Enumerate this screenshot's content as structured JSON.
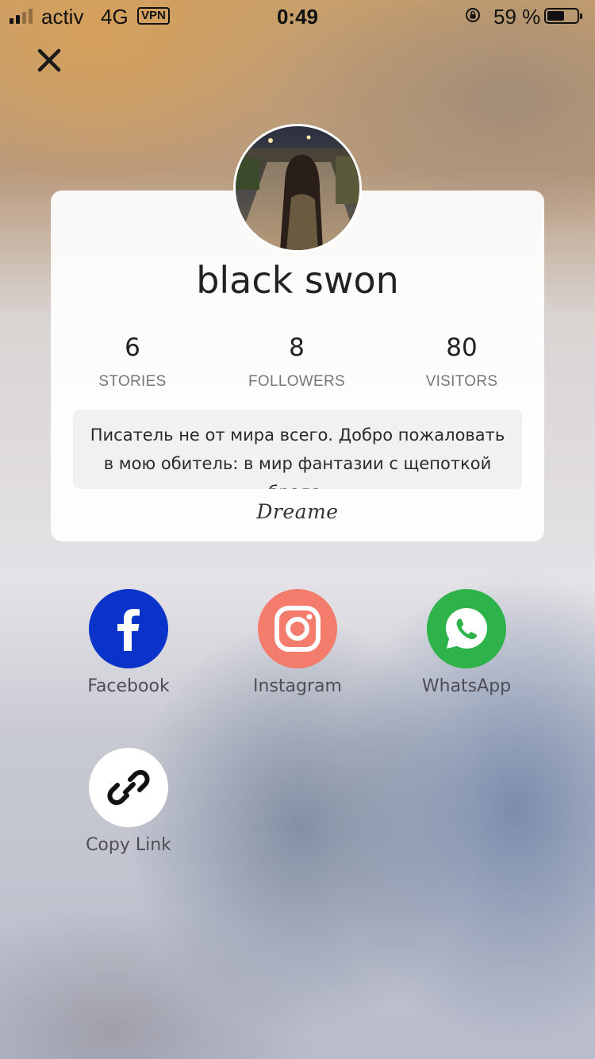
{
  "status_bar": {
    "carrier": "activ",
    "network": "4G",
    "vpn": "VPN",
    "time": "0:49",
    "battery_percent": "59 %",
    "battery_level": 0.59,
    "signal_bars": 2
  },
  "profile": {
    "name": "black swon",
    "stats": [
      {
        "value": "6",
        "label": "STORIES"
      },
      {
        "value": "8",
        "label": "FOLLOWERS"
      },
      {
        "value": "80",
        "label": "VISITORS"
      }
    ],
    "bio": "Писатель не от мира всего. Добро пожаловать в мою обитель: в мир фантазии с щепоткой бреда,",
    "brand": "Dreame"
  },
  "share_options": [
    {
      "label": "Facebook",
      "icon": "facebook-icon",
      "color": "#0a34c9"
    },
    {
      "label": "Instagram",
      "icon": "instagram-icon",
      "color": "#f47c6c"
    },
    {
      "label": "WhatsApp",
      "icon": "whatsapp-icon",
      "color": "#2db34a"
    },
    {
      "label": "Copy Link",
      "icon": "link-icon",
      "color": "#ffffff"
    }
  ]
}
